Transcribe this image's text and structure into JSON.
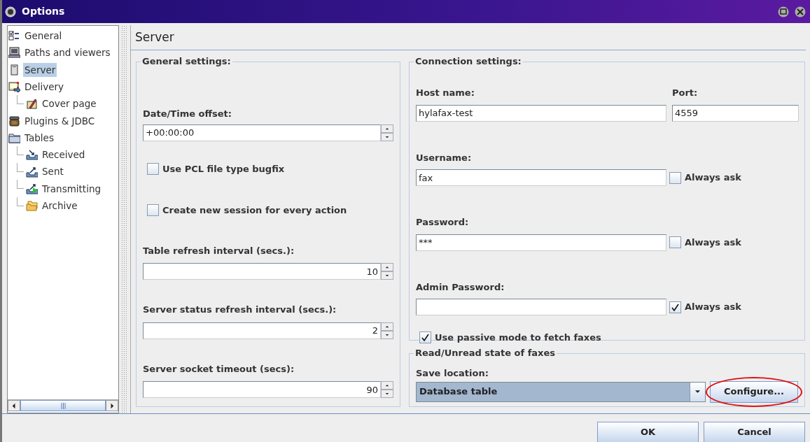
{
  "window": {
    "title": "Options"
  },
  "sidebar": {
    "items": [
      {
        "label": "General",
        "kind": "general",
        "selected": false
      },
      {
        "label": "Paths and viewers",
        "kind": "monitor",
        "selected": false
      },
      {
        "label": "Server",
        "kind": "server",
        "selected": true
      },
      {
        "label": "Delivery",
        "kind": "delivery",
        "selected": false,
        "children": [
          {
            "label": "Cover page",
            "kind": "cover",
            "selected": false
          }
        ]
      },
      {
        "label": "Plugins & JDBC",
        "kind": "plugin",
        "selected": false
      },
      {
        "label": "Tables",
        "kind": "folder",
        "selected": false,
        "children": [
          {
            "label": "Received",
            "kind": "received",
            "selected": false
          },
          {
            "label": "Sent",
            "kind": "sent",
            "selected": false
          },
          {
            "label": "Transmitting",
            "kind": "transmitting",
            "selected": false
          },
          {
            "label": "Archive",
            "kind": "archive",
            "selected": false
          }
        ]
      }
    ]
  },
  "page_title": "Server",
  "general_settings": {
    "title": "General settings:",
    "fields": [
      {
        "kind": "text-spinner",
        "label": "Date/Time offset:",
        "value": "+00:00:00"
      },
      {
        "kind": "checkbox",
        "label": "Use PCL file type bugfix",
        "checked": false
      },
      {
        "kind": "checkbox",
        "label": "Create new session for every action",
        "checked": false
      },
      {
        "kind": "number-spinner",
        "label": "Table refresh interval (secs.):",
        "value": "10"
      },
      {
        "kind": "number-spinner",
        "label": "Server status refresh interval (secs.):",
        "value": "2"
      },
      {
        "kind": "number-spinner",
        "label": "Server socket timeout (secs):",
        "value": "90"
      }
    ]
  },
  "connection_settings": {
    "title": "Connection settings:",
    "host": {
      "label": "Host name:",
      "value": "hylafax-test"
    },
    "port": {
      "label": "Port:",
      "value": "4559"
    },
    "credentials": [
      {
        "label": "Username:",
        "value": "fax",
        "always_ask": {
          "label": "Always ask",
          "checked": false
        }
      },
      {
        "label": "Password:",
        "value": "***",
        "always_ask": {
          "label": "Always ask",
          "checked": false
        }
      },
      {
        "label": "Admin Password:",
        "always_ask": {
          "label": "Always ask",
          "checked": true
        }
      }
    ],
    "passive_mode": {
      "label": "Use passive mode to fetch faxes",
      "checked": true
    }
  },
  "read_state": {
    "title": "Read/Unread state of faxes",
    "save_location": {
      "label": "Save location:",
      "value": "Database table"
    },
    "configure": {
      "label": "Configure...",
      "circled": true
    }
  },
  "buttons": [
    {
      "label": "OK"
    },
    {
      "label": "Cancel"
    }
  ]
}
